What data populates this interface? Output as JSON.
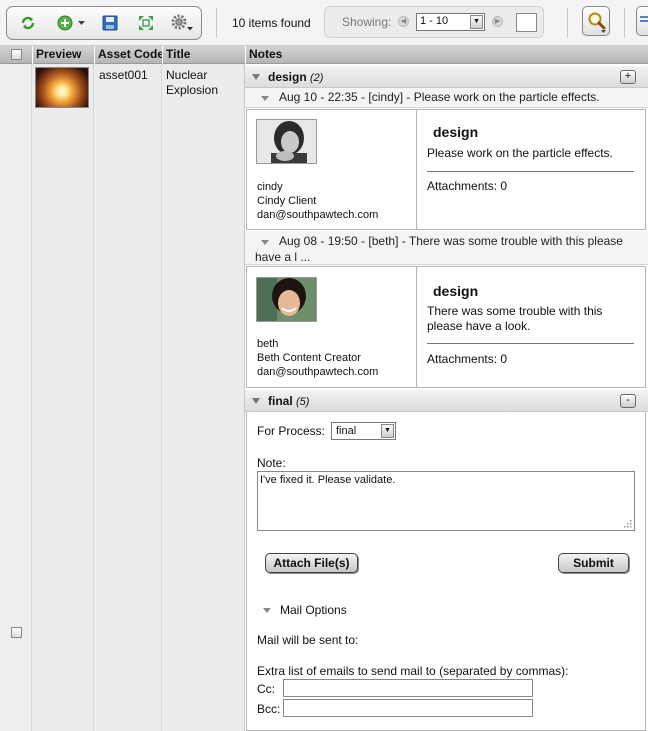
{
  "toolbar": {
    "icons": [
      "refresh-icon",
      "add-icon",
      "save-icon",
      "expand-icon",
      "gear-icon"
    ],
    "items_found": "10 items found",
    "showing_label": "Showing:",
    "page_range": "1 - 10",
    "page_input": ""
  },
  "table": {
    "columns": [
      "",
      "Preview",
      "Asset Code",
      "Title",
      "Notes"
    ],
    "row": {
      "asset_code": "asset001",
      "title": "Nuclear Explosion"
    }
  },
  "notes": {
    "contexts": [
      {
        "name": "design",
        "count": "(2)",
        "toggle": "+",
        "notes": [
          {
            "header": "Aug 10 - 22:35 - [cindy] - Please work on the particle effects.",
            "login": "cindy",
            "display_name": "Cindy Client",
            "email": "dan@southpawtech.com",
            "context": "design",
            "body": "Please work on the particle effects.",
            "attachments": "Attachments: 0"
          },
          {
            "header": "Aug 08 - 19:50 - [beth] - There was some trouble with this please have a l ...",
            "login": "beth",
            "display_name": "Beth Content Creator",
            "email": "dan@southpawtech.com",
            "context": "design",
            "body": "There was some trouble with this please have a look.",
            "attachments": "Attachments: 0"
          }
        ]
      },
      {
        "name": "final",
        "count": "(5)",
        "toggle": "-"
      }
    ],
    "form": {
      "for_process_label": "For Process:",
      "process_value": "final",
      "note_label": "Note:",
      "note_value": "I've fixed it.  Please validate.",
      "attach_button": "Attach File(s)",
      "submit_button": "Submit",
      "mail_options_label": "Mail Options",
      "mail_sent_to": "Mail will be sent to:",
      "extra_emails_label": "Extra list of emails to send mail to (separated by commas):",
      "cc_label": "Cc:",
      "bcc_label": "Bcc:",
      "cc_value": "",
      "bcc_value": ""
    }
  }
}
